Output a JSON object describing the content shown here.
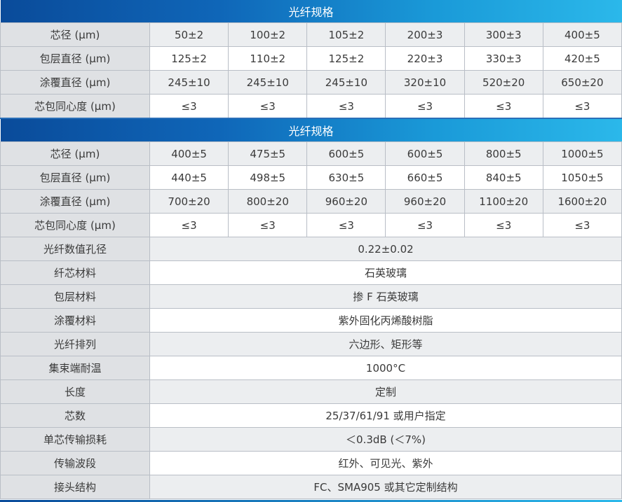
{
  "section1": {
    "title": "光纤规格",
    "rows": [
      {
        "label": "芯径 (μm)",
        "values": [
          "50±2",
          "100±2",
          "105±2",
          "200±3",
          "300±3",
          "400±5"
        ]
      },
      {
        "label": "包层直径 (μm)",
        "values": [
          "125±2",
          "110±2",
          "125±2",
          "220±3",
          "330±3",
          "420±5"
        ]
      },
      {
        "label": "涂覆直径 (μm)",
        "values": [
          "245±10",
          "245±10",
          "245±10",
          "320±10",
          "520±20",
          "650±20"
        ]
      },
      {
        "label": "芯包同心度 (μm)",
        "values": [
          "≤3",
          "≤3",
          "≤3",
          "≤3",
          "≤3",
          "≤3"
        ]
      }
    ]
  },
  "section2": {
    "title": "光纤规格",
    "rows": [
      {
        "label": "芯径 (μm)",
        "values": [
          "400±5",
          "475±5",
          "600±5",
          "600±5",
          "800±5",
          "1000±5"
        ]
      },
      {
        "label": "包层直径 (μm)",
        "values": [
          "440±5",
          "498±5",
          "630±5",
          "660±5",
          "840±5",
          "1050±5"
        ]
      },
      {
        "label": "涂覆直径 (μm)",
        "values": [
          "700±20",
          "800±20",
          "960±20",
          "960±20",
          "1100±20",
          "1600±20"
        ]
      },
      {
        "label": "芯包同心度 (μm)",
        "values": [
          "≤3",
          "≤3",
          "≤3",
          "≤3",
          "≤3",
          "≤3"
        ]
      }
    ]
  },
  "properties": [
    {
      "label": "光纤数值孔径",
      "value": "0.22±0.02"
    },
    {
      "label": "纤芯材料",
      "value": "石英玻璃"
    },
    {
      "label": "包层材料",
      "value": "掺 F 石英玻璃"
    },
    {
      "label": "涂覆材料",
      "value": "紫外固化丙烯酸树脂"
    },
    {
      "label": "光纤排列",
      "value": "六边形、矩形等"
    },
    {
      "label": "集束端耐温",
      "value": "1000°C"
    },
    {
      "label": "长度",
      "value": "定制"
    },
    {
      "label": "芯数",
      "value": "25/37/61/91 或用户指定"
    },
    {
      "label": "单芯传输损耗",
      "value": "＜0.3dB (＜7%)"
    },
    {
      "label": "传输波段",
      "value": "红外、可见光、紫外"
    },
    {
      "label": "接头结构",
      "value": "FC、SMA905 或其它定制结构"
    }
  ],
  "colors": {
    "header_start": "#0a4b9a",
    "header_end": "#2bb8ea",
    "label_bg": "#dfe1e4",
    "shade_bg": "#eceef0"
  }
}
